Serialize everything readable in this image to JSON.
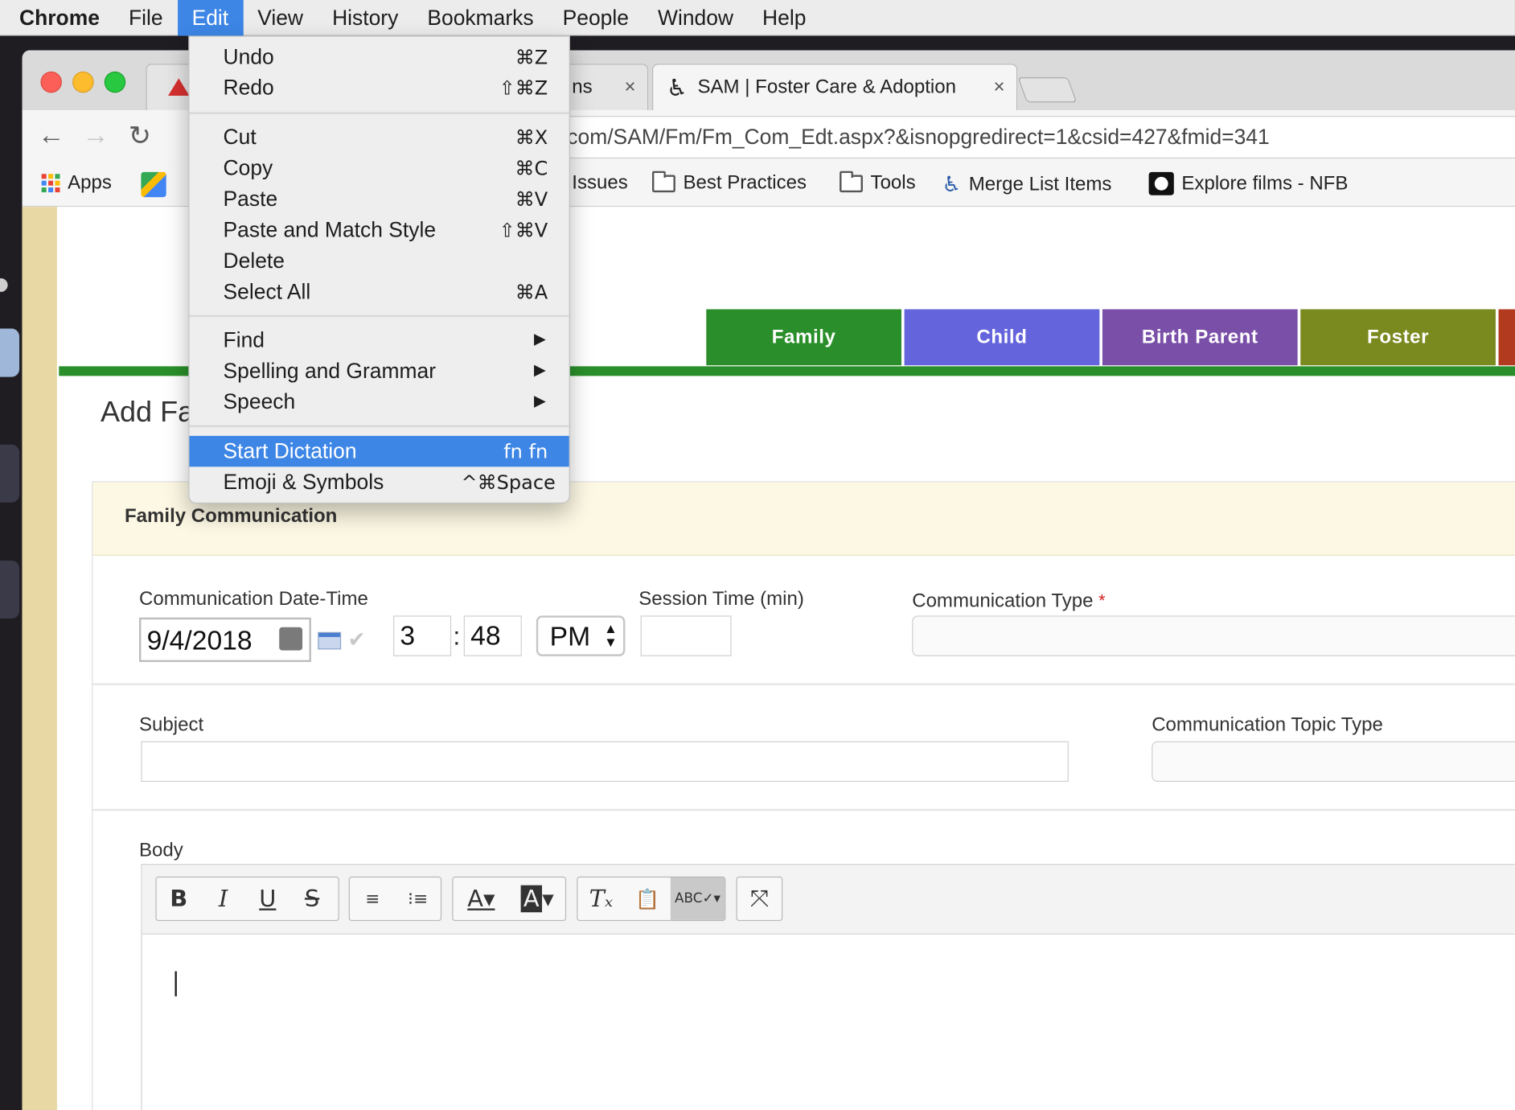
{
  "menubar": {
    "items": [
      "Chrome",
      "File",
      "Edit",
      "View",
      "History",
      "Bookmarks",
      "People",
      "Window",
      "Help"
    ]
  },
  "tabs": {
    "left_visible_text": "ns",
    "active_title": "SAM | Foster Care & Adoption",
    "close_glyph": "×"
  },
  "toolbar": {
    "url": "com/SAM/Fm/Fm_Com_Edt.aspx?&isnopgredirect=1&csid=427&fmid=341"
  },
  "bookmarks": {
    "apps": "Apps",
    "issues": "Issues",
    "best_practices": "Best Practices",
    "tools": "Tools",
    "merge_list": "Merge List Items",
    "explore_films": "Explore films - NFB"
  },
  "page": {
    "tabs": [
      {
        "label": "Family",
        "color": "#2a8f2a"
      },
      {
        "label": "Child",
        "color": "#6464dc"
      },
      {
        "label": "Birth Parent",
        "color": "#7a4fa8"
      },
      {
        "label": "Foster",
        "color": "#7b8a1f"
      }
    ],
    "heading": "Add Fa",
    "section_title": "Family Communication",
    "labels": {
      "datetime": "Communication Date-Time",
      "session": "Session Time (min)",
      "comm_type": "Communication Type",
      "subject": "Subject",
      "topic_type": "Communication Topic Type",
      "body": "Body"
    },
    "required_mark": "*",
    "values": {
      "date": "9/4/2018",
      "hour": "3",
      "minute": "48",
      "ampm": "PM",
      "time_sep": ":"
    }
  },
  "edit_menu": {
    "undo": {
      "label": "Undo",
      "shortcut": "⌘Z"
    },
    "redo": {
      "label": "Redo",
      "shortcut": "⇧⌘Z"
    },
    "cut": {
      "label": "Cut",
      "shortcut": "⌘X"
    },
    "copy": {
      "label": "Copy",
      "shortcut": "⌘C"
    },
    "paste": {
      "label": "Paste",
      "shortcut": "⌘V"
    },
    "paste_match": {
      "label": "Paste and Match Style",
      "shortcut": "⇧⌘V"
    },
    "delete": {
      "label": "Delete"
    },
    "select_all": {
      "label": "Select All",
      "shortcut": "⌘A"
    },
    "find": {
      "label": "Find"
    },
    "spelling": {
      "label": "Spelling and Grammar"
    },
    "speech": {
      "label": "Speech"
    },
    "dictation": {
      "label": "Start Dictation",
      "shortcut": "fn fn"
    },
    "emoji": {
      "label": "Emoji & Symbols",
      "shortcut": "^⌘Space"
    }
  },
  "colors": {
    "menu_highlight": "#3d86e6",
    "page_green": "#2a8f2a",
    "required_red": "#d02020"
  }
}
